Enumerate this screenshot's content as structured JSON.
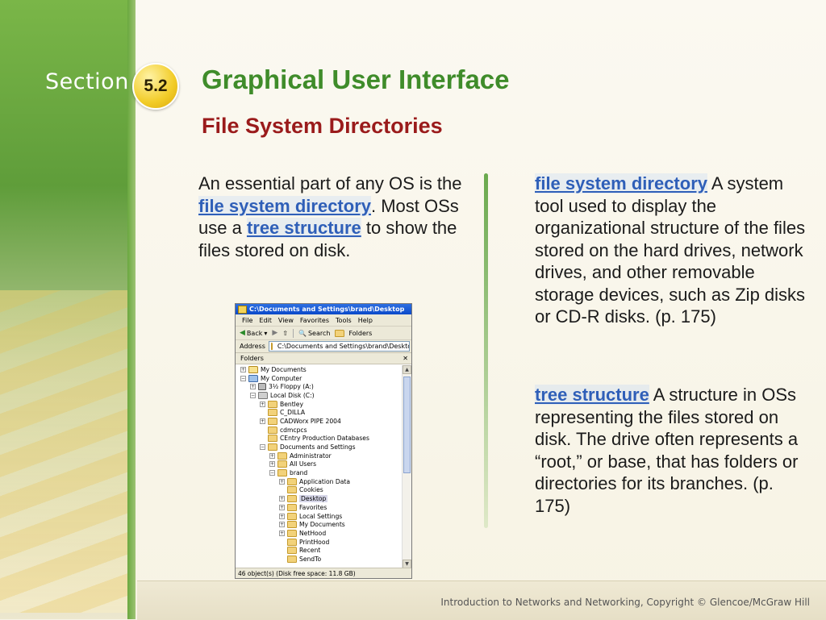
{
  "header": {
    "section_word": "Section",
    "section_number": "5.2",
    "title": "Graphical User Interface",
    "subtitle": "File System Directories"
  },
  "body": {
    "p1": "An essential part of any OS is the ",
    "kw1": "file system directory",
    "p2": ". Most OSs use a ",
    "kw2": "tree structure",
    "p3": " to show the files stored on disk."
  },
  "definitions": [
    {
      "term": "file system directory",
      "text": " A system tool used to display the organizational structure of the files stored on the hard drives, network drives, and other removable storage devices, such as Zip disks or CD-R disks. (p. 175)"
    },
    {
      "term": "tree structure",
      "text": " A structure in OSs representing the files stored on disk. The drive often represents a “root,” or base, that has folders or directories for its branches. (p. 175)"
    }
  ],
  "explorer": {
    "title": "C:\\Documents and Settings\\brand\\Desktop",
    "menu": [
      "File",
      "Edit",
      "View",
      "Favorites",
      "Tools",
      "Help"
    ],
    "toolbar": {
      "back": "Back",
      "search": "Search",
      "folders": "Folders"
    },
    "address_label": "Address",
    "address_value": "C:\\Documents and Settings\\brand\\Desktop",
    "folders_label": "Folders",
    "close_glyph": "✕",
    "tree": [
      {
        "label": "My Documents",
        "level": 0,
        "pm": "+",
        "icon": "docs"
      },
      {
        "label": "My Computer",
        "level": 0,
        "pm": "−",
        "icon": "pc"
      },
      {
        "label": "3½ Floppy (A:)",
        "level": 1,
        "pm": "+",
        "icon": "floppy"
      },
      {
        "label": "Local Disk (C:)",
        "level": 1,
        "pm": "−",
        "icon": "drive"
      },
      {
        "label": "Bentley",
        "level": 2,
        "pm": "+",
        "icon": "folder"
      },
      {
        "label": "C_DILLA",
        "level": 2,
        "pm": "",
        "icon": "folder"
      },
      {
        "label": "CADWorx PIPE 2004",
        "level": 2,
        "pm": "+",
        "icon": "folder"
      },
      {
        "label": "cdmcpcs",
        "level": 2,
        "pm": "",
        "icon": "folder"
      },
      {
        "label": "CEntry Production Databases",
        "level": 2,
        "pm": "",
        "icon": "folder"
      },
      {
        "label": "Documents and Settings",
        "level": 2,
        "pm": "−",
        "icon": "folder"
      },
      {
        "label": "Administrator",
        "level": 3,
        "pm": "+",
        "icon": "folder"
      },
      {
        "label": "All Users",
        "level": 3,
        "pm": "+",
        "icon": "folder"
      },
      {
        "label": "brand",
        "level": 3,
        "pm": "−",
        "icon": "folder"
      },
      {
        "label": "Application Data",
        "level": 4,
        "pm": "+",
        "icon": "folder"
      },
      {
        "label": "Cookies",
        "level": 4,
        "pm": "",
        "icon": "folder"
      },
      {
        "label": "Desktop",
        "level": 4,
        "pm": "+",
        "icon": "folder",
        "selected": true
      },
      {
        "label": "Favorites",
        "level": 4,
        "pm": "+",
        "icon": "folder"
      },
      {
        "label": "Local Settings",
        "level": 4,
        "pm": "+",
        "icon": "folder"
      },
      {
        "label": "My Documents",
        "level": 4,
        "pm": "+",
        "icon": "folder"
      },
      {
        "label": "NetHood",
        "level": 4,
        "pm": "+",
        "icon": "folder"
      },
      {
        "label": "PrintHood",
        "level": 4,
        "pm": "",
        "icon": "folder"
      },
      {
        "label": "Recent",
        "level": 4,
        "pm": "",
        "icon": "folder"
      },
      {
        "label": "SendTo",
        "level": 4,
        "pm": "",
        "icon": "folder"
      }
    ],
    "status": "46 object(s) (Disk free space: 11.8 GB)"
  },
  "footer": "Introduction to Networks and Networking, Copyright © Glencoe/McGraw Hill",
  "colors": {
    "title_green": "#3f8c2a",
    "subtitle_red": "#9a1b1b",
    "keyword_blue": "#2f5fb8",
    "badge_yellow": "#f2cc28"
  }
}
